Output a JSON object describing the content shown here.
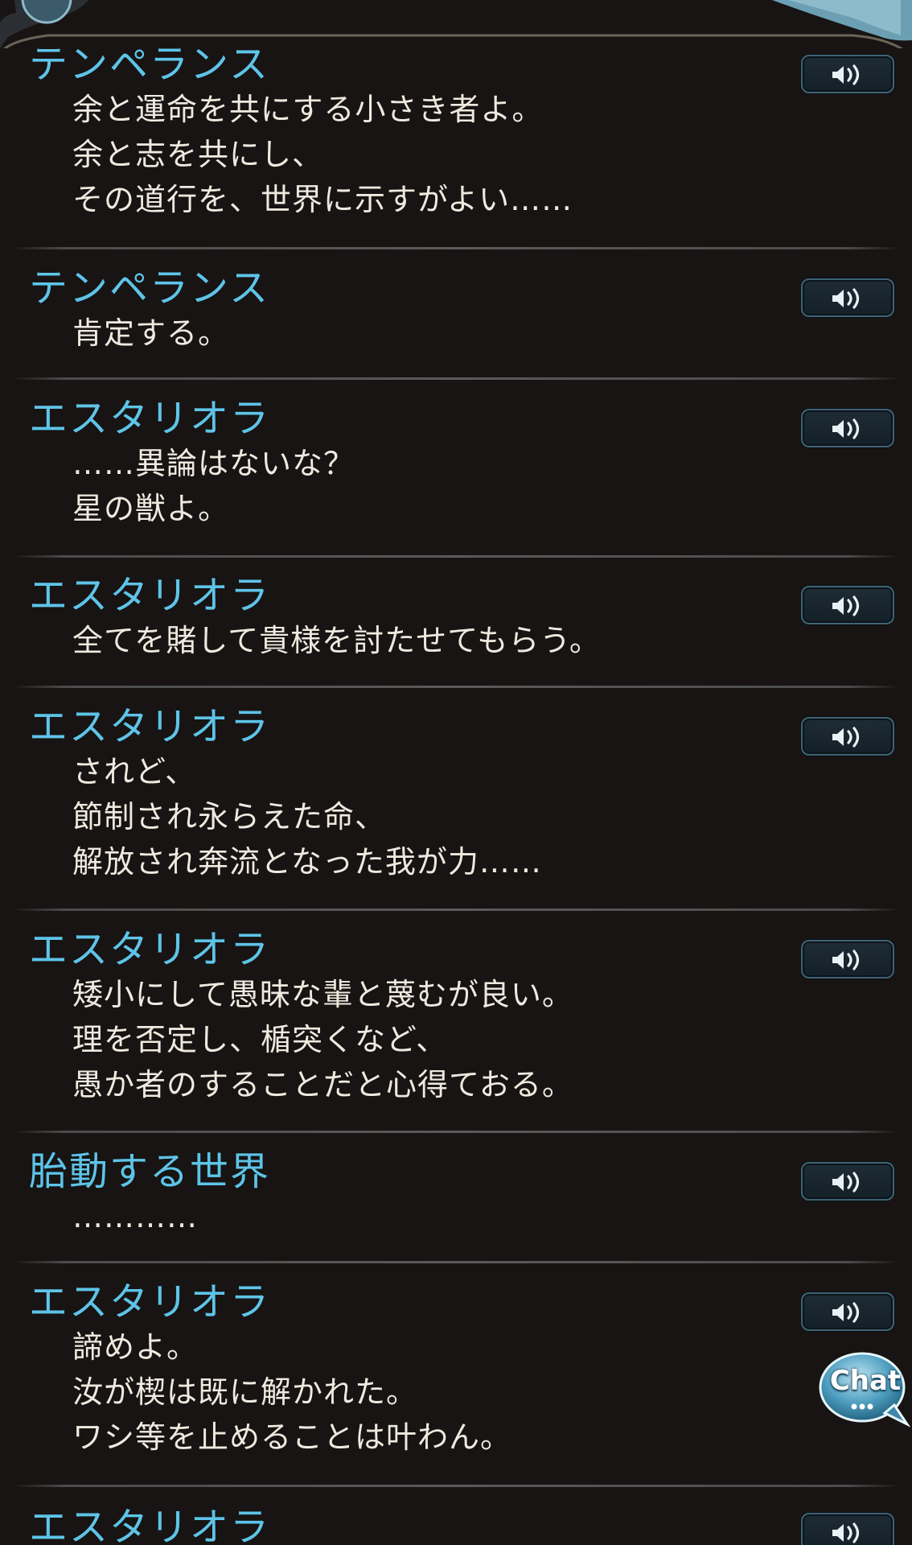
{
  "log_entries": [
    {
      "speaker": "テンペランス",
      "lines": [
        "余と運命を共にする小さき者よ。",
        "余と志を共にし、",
        "その道行を、世界に示すがよい……"
      ]
    },
    {
      "speaker": "テンペランス",
      "lines": [
        "肯定する。"
      ]
    },
    {
      "speaker": "エスタリオラ",
      "lines": [
        "……異論はないな？",
        "星の獣よ。"
      ]
    },
    {
      "speaker": "エスタリオラ",
      "lines": [
        "全てを賭して貴様を討たせてもらう。"
      ]
    },
    {
      "speaker": "エスタリオラ",
      "lines": [
        "されど、",
        "節制され永らえた命、",
        "解放され奔流となった我が力……"
      ]
    },
    {
      "speaker": "エスタリオラ",
      "lines": [
        "矮小にして愚昧な輩と蔑むが良い。",
        "理を否定し、楯突くなど、",
        "愚か者のすることだと心得ておる。"
      ]
    },
    {
      "speaker": "胎動する世界",
      "lines": [
        "…………"
      ]
    },
    {
      "speaker": "エスタリオラ",
      "lines": [
        "諦めよ。",
        "汝が楔は既に解かれた。",
        "ワシ等を止めることは叶わん。"
      ]
    },
    {
      "speaker": "エスタリオラ",
      "lines": []
    }
  ],
  "chat_button": {
    "label": "Chat"
  },
  "icons": {
    "voice": "speaker-icon",
    "chat": "chat-bubble-icon"
  },
  "colors": {
    "speaker_name": "#5ec4e8",
    "dialogue_text": "#efe9df",
    "background": "#171413"
  }
}
